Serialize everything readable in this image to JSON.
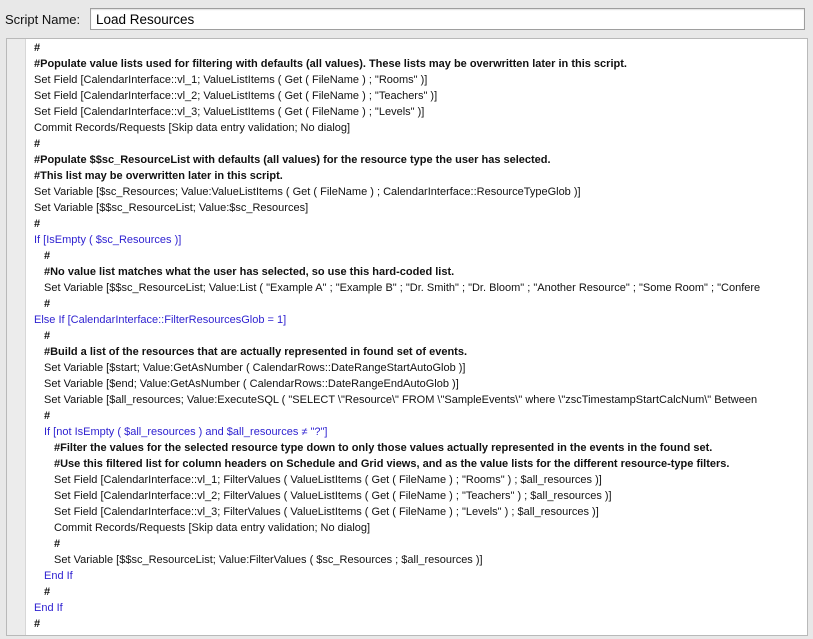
{
  "script_name": {
    "label": "Script Name:",
    "value": "Load Resources"
  },
  "script_steps": [
    {
      "indent": 0,
      "kind": "comment",
      "text": "#"
    },
    {
      "indent": 0,
      "kind": "comment",
      "text": "#Populate value lists used for filtering with defaults (all values). These lists may be overwritten later in this script."
    },
    {
      "indent": 0,
      "kind": "step",
      "text": "Set Field [CalendarInterface::vl_1; ValueListItems ( Get ( FileName ) ; \"Rooms\" )]"
    },
    {
      "indent": 0,
      "kind": "step",
      "text": "Set Field [CalendarInterface::vl_2; ValueListItems ( Get ( FileName ) ; \"Teachers\" )]"
    },
    {
      "indent": 0,
      "kind": "step",
      "text": "Set Field [CalendarInterface::vl_3; ValueListItems ( Get ( FileName ) ; \"Levels\" )]"
    },
    {
      "indent": 0,
      "kind": "step",
      "text": "Commit Records/Requests [Skip data entry validation; No dialog]"
    },
    {
      "indent": 0,
      "kind": "comment",
      "text": "#"
    },
    {
      "indent": 0,
      "kind": "comment",
      "text": "#Populate $$sc_ResourceList with defaults (all values) for the resource type the user has selected."
    },
    {
      "indent": 0,
      "kind": "comment",
      "text": "#This list may be overwritten later in this script."
    },
    {
      "indent": 0,
      "kind": "step",
      "text": "Set Variable [$sc_Resources; Value:ValueListItems ( Get ( FileName ) ; CalendarInterface::ResourceTypeGlob )]"
    },
    {
      "indent": 0,
      "kind": "step",
      "text": "Set Variable [$$sc_ResourceList; Value:$sc_Resources]"
    },
    {
      "indent": 0,
      "kind": "comment",
      "text": "#"
    },
    {
      "indent": 0,
      "kind": "control",
      "text": "If [IsEmpty ( $sc_Resources )]"
    },
    {
      "indent": 1,
      "kind": "comment",
      "text": "#"
    },
    {
      "indent": 1,
      "kind": "comment",
      "text": "#No value list matches what the user has selected, so use this hard-coded list."
    },
    {
      "indent": 1,
      "kind": "step",
      "text": "Set Variable [$$sc_ResourceList; Value:List ( \"Example A\" ; \"Example B\" ; \"Dr. Smith\" ; \"Dr. Bloom\" ; \"Another Resource\" ; \"Some Room\" ; \"Confere"
    },
    {
      "indent": 1,
      "kind": "comment",
      "text": "#"
    },
    {
      "indent": 0,
      "kind": "control",
      "text": "Else If [CalendarInterface::FilterResourcesGlob = 1]"
    },
    {
      "indent": 1,
      "kind": "comment",
      "text": "#"
    },
    {
      "indent": 1,
      "kind": "comment",
      "text": "#Build a list of the resources that are actually represented in found set of events."
    },
    {
      "indent": 1,
      "kind": "step",
      "text": "Set Variable [$start; Value:GetAsNumber ( CalendarRows::DateRangeStartAutoGlob )]"
    },
    {
      "indent": 1,
      "kind": "step",
      "text": "Set Variable [$end; Value:GetAsNumber ( CalendarRows::DateRangeEndAutoGlob )]"
    },
    {
      "indent": 1,
      "kind": "step",
      "text": "Set Variable [$all_resources; Value:ExecuteSQL (  \"SELECT \\\"Resource\\\" FROM \\\"SampleEvents\\\" where \\\"zscTimestampStartCalcNum\\\" Between"
    },
    {
      "indent": 1,
      "kind": "comment",
      "text": "#"
    },
    {
      "indent": 1,
      "kind": "control",
      "text": "If [not IsEmpty ( $all_resources ) and $all_resources ≠ \"?\"]"
    },
    {
      "indent": 2,
      "kind": "comment",
      "text": "#Filter the values for the selected resource type down to only those values actually represented in the events in the found set."
    },
    {
      "indent": 2,
      "kind": "comment",
      "text": "#Use this filtered list for column headers on Schedule and Grid views, and as the value lists for the different resource-type filters."
    },
    {
      "indent": 2,
      "kind": "step",
      "text": "Set Field [CalendarInterface::vl_1; FilterValues ( ValueListItems ( Get ( FileName ) ; \"Rooms\" ) ; $all_resources )]"
    },
    {
      "indent": 2,
      "kind": "step",
      "text": "Set Field [CalendarInterface::vl_2; FilterValues ( ValueListItems ( Get ( FileName ) ; \"Teachers\" ) ; $all_resources )]"
    },
    {
      "indent": 2,
      "kind": "step",
      "text": "Set Field [CalendarInterface::vl_3; FilterValues ( ValueListItems ( Get ( FileName ) ; \"Levels\" ) ; $all_resources )]"
    },
    {
      "indent": 2,
      "kind": "step",
      "text": "Commit Records/Requests [Skip data entry validation; No dialog]"
    },
    {
      "indent": 2,
      "kind": "comment",
      "text": "#"
    },
    {
      "indent": 2,
      "kind": "step",
      "text": "Set Variable [$$sc_ResourceList; Value:FilterValues ( $sc_Resources ; $all_resources )]"
    },
    {
      "indent": 1,
      "kind": "control",
      "text": "End If"
    },
    {
      "indent": 1,
      "kind": "comment",
      "text": "#"
    },
    {
      "indent": 0,
      "kind": "control",
      "text": "End If"
    },
    {
      "indent": 0,
      "kind": "comment",
      "text": "#"
    }
  ],
  "colors": {
    "control_keyword": "#2c1fd0",
    "step_text": "#111111"
  }
}
